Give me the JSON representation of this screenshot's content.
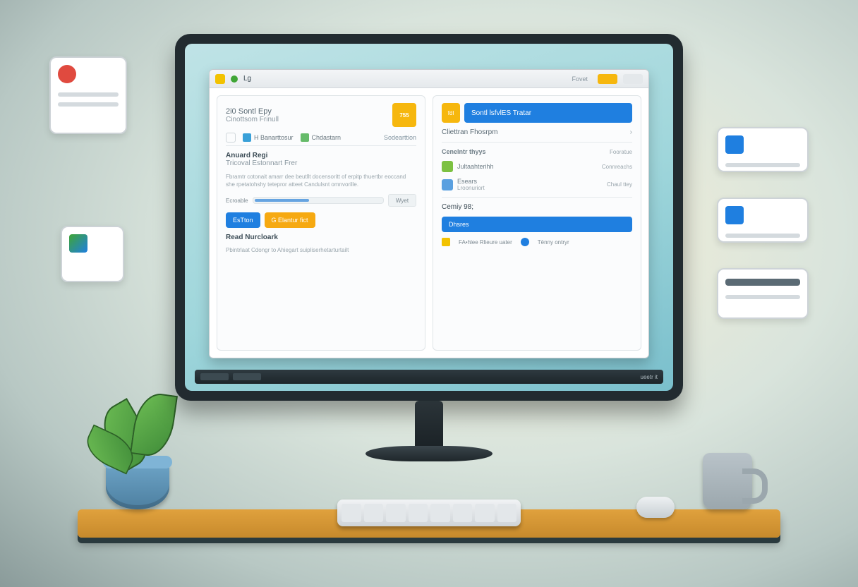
{
  "titlebar": {
    "label": "Lg"
  },
  "left_panel": {
    "header_line1": "2i0 Sontl Epy",
    "header_line2": "Cinottsom Frinull",
    "icon_badge": "755",
    "tabs": [
      {
        "icon_color": "#39a0d8",
        "label": "H Banarttosur"
      },
      {
        "icon_color": "#66bb6a",
        "label": "Chdastarn"
      }
    ],
    "tabs_link": "Sodearttion",
    "section1_title": "Anuard Regi",
    "section1_sub": "Tricoval Estonnart Frer",
    "section1_body": "Fbramtr cotonait amarr dee beutllt docensoritt of erpitp thuertbr eoccand she rpetatohshy tetepror atteet Candulsnt omnvorille.",
    "progress_label": "Ecroable",
    "progress_meta": "Wyet",
    "btn_primary": "EsTton",
    "btn_secondary": "G Elantur fict",
    "section2_title": "Read Nurcloark",
    "section2_body": "Pbintrlaat Cdongr to Ahiegart suipliserhetarturtailt"
  },
  "right_panel": {
    "header_badge": "fdl",
    "header": "Sontl lsfvlES Tratar",
    "sub1": "Cliettran Fhosrpm",
    "sub1_icon": "›",
    "group_title": "Cenelntr thyys",
    "group_meta": "Fooratue",
    "rows": [
      {
        "icon_color": "#7cc142",
        "label": "Jultaahterihh",
        "meta": "Connreachs"
      },
      {
        "icon_color": "#5aa0e0",
        "label": "Esears",
        "meta": "Chaul ttey"
      }
    ],
    "row2_sub": "Lroonuriort",
    "counter_label": "Cemiy 98;",
    "wide_btn": "Dhsres",
    "footer": [
      {
        "icon_color": "#f2c200",
        "label": "FA•hlee  Rlieure uater"
      },
      {
        "icon_color": "#1f7fe0",
        "label": "Tënny ontryr"
      }
    ]
  },
  "taskbar": {
    "right_text": "ueetr it"
  },
  "badge_top": {
    "label": "Fovet"
  }
}
